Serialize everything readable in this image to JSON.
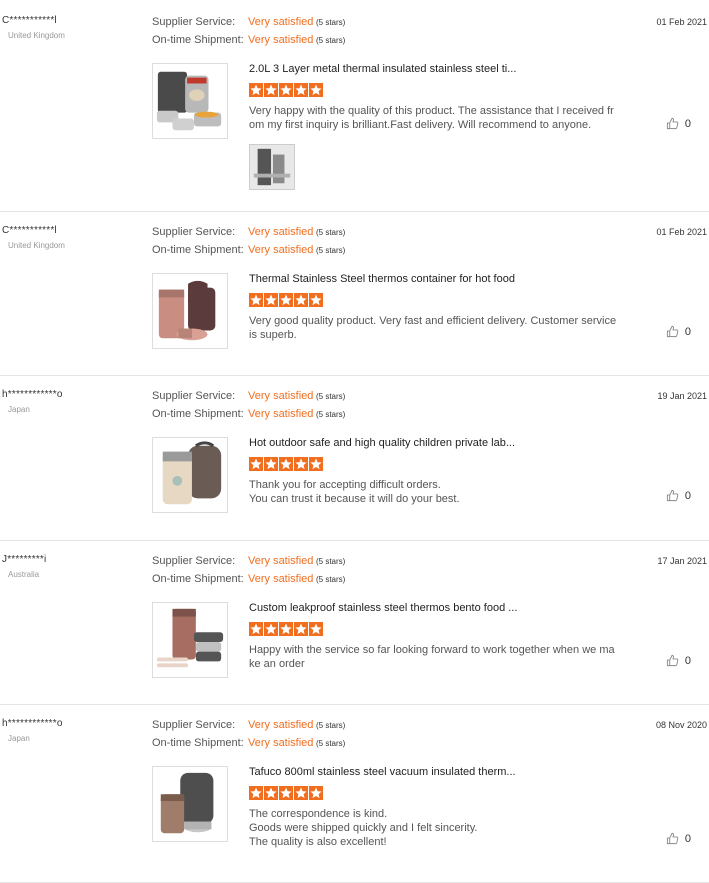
{
  "labels": {
    "supplier_service": "Supplier Service:",
    "shipment": "On-time Shipment:"
  },
  "colors": {
    "accent": "#f26e1f"
  },
  "reviews": [
    {
      "buyer": "C***********l",
      "country": "United Kingdom",
      "supplier_rating": "Very satisfied",
      "supplier_stars": "(5 stars)",
      "shipment_rating": "Very satisfied",
      "shipment_stars": "(5 stars)",
      "date": "01 Feb 2021",
      "product_title": "2.0L 3 Layer metal thermal insulated stainless steel ti...",
      "product_image": "thermal-lunch-box-set-image",
      "star_rating": 5,
      "comment": "Very happy with the quality of this product. The assistance that I received from my first inquiry is brilliant.Fast delivery. Will recommend to anyone.",
      "helpful_count": "0",
      "has_attachment": true
    },
    {
      "buyer": "C***********l",
      "country": "United Kingdom",
      "supplier_rating": "Very satisfied",
      "supplier_stars": "(5 stars)",
      "shipment_rating": "Very satisfied",
      "shipment_stars": "(5 stars)",
      "date": "01 Feb 2021",
      "product_title": "Thermal Stainless Steel thermos container for hot food",
      "product_image": "rose-gold-food-jar-image",
      "star_rating": 5,
      "comment": "Very good quality product. Very fast and efficient delivery. Customer service is superb.",
      "helpful_count": "0",
      "has_attachment": false
    },
    {
      "buyer": "h************o",
      "country": "Japan",
      "supplier_rating": "Very satisfied",
      "supplier_stars": "(5 stars)",
      "shipment_rating": "Very satisfied",
      "shipment_stars": "(5 stars)",
      "date": "19 Jan 2021",
      "product_title": "Hot outdoor safe and high quality children private lab...",
      "product_image": "beige-food-jar-with-bag-image",
      "star_rating": 5,
      "comment": "Thank you for accepting difficult orders.\nYou can trust it because it will do your best.",
      "helpful_count": "0",
      "has_attachment": false
    },
    {
      "buyer": "J*********i",
      "country": "Australia",
      "supplier_rating": "Very satisfied",
      "supplier_stars": "(5 stars)",
      "shipment_rating": "Very satisfied",
      "shipment_stars": "(5 stars)",
      "date": "17 Jan 2021",
      "product_title": "Custom leakproof stainless steel thermos bento food ...",
      "product_image": "rose-thermos-bento-image",
      "star_rating": 5,
      "comment": "Happy with the service so far looking forward to work together when we make an order",
      "helpful_count": "0",
      "has_attachment": false
    },
    {
      "buyer": "h************o",
      "country": "Japan",
      "supplier_rating": "Very satisfied",
      "supplier_stars": "(5 stars)",
      "shipment_rating": "Very satisfied",
      "shipment_stars": "(5 stars)",
      "date": "08 Nov 2020",
      "product_title": "Tafuco 800ml stainless steel vacuum insulated therm...",
      "product_image": "bronze-food-jar-set-image",
      "star_rating": 5,
      "comment": "The correspondence is kind.\nGoods were shipped quickly and I felt sincerity.\nThe quality is also excellent!",
      "helpful_count": "0",
      "has_attachment": false
    }
  ]
}
